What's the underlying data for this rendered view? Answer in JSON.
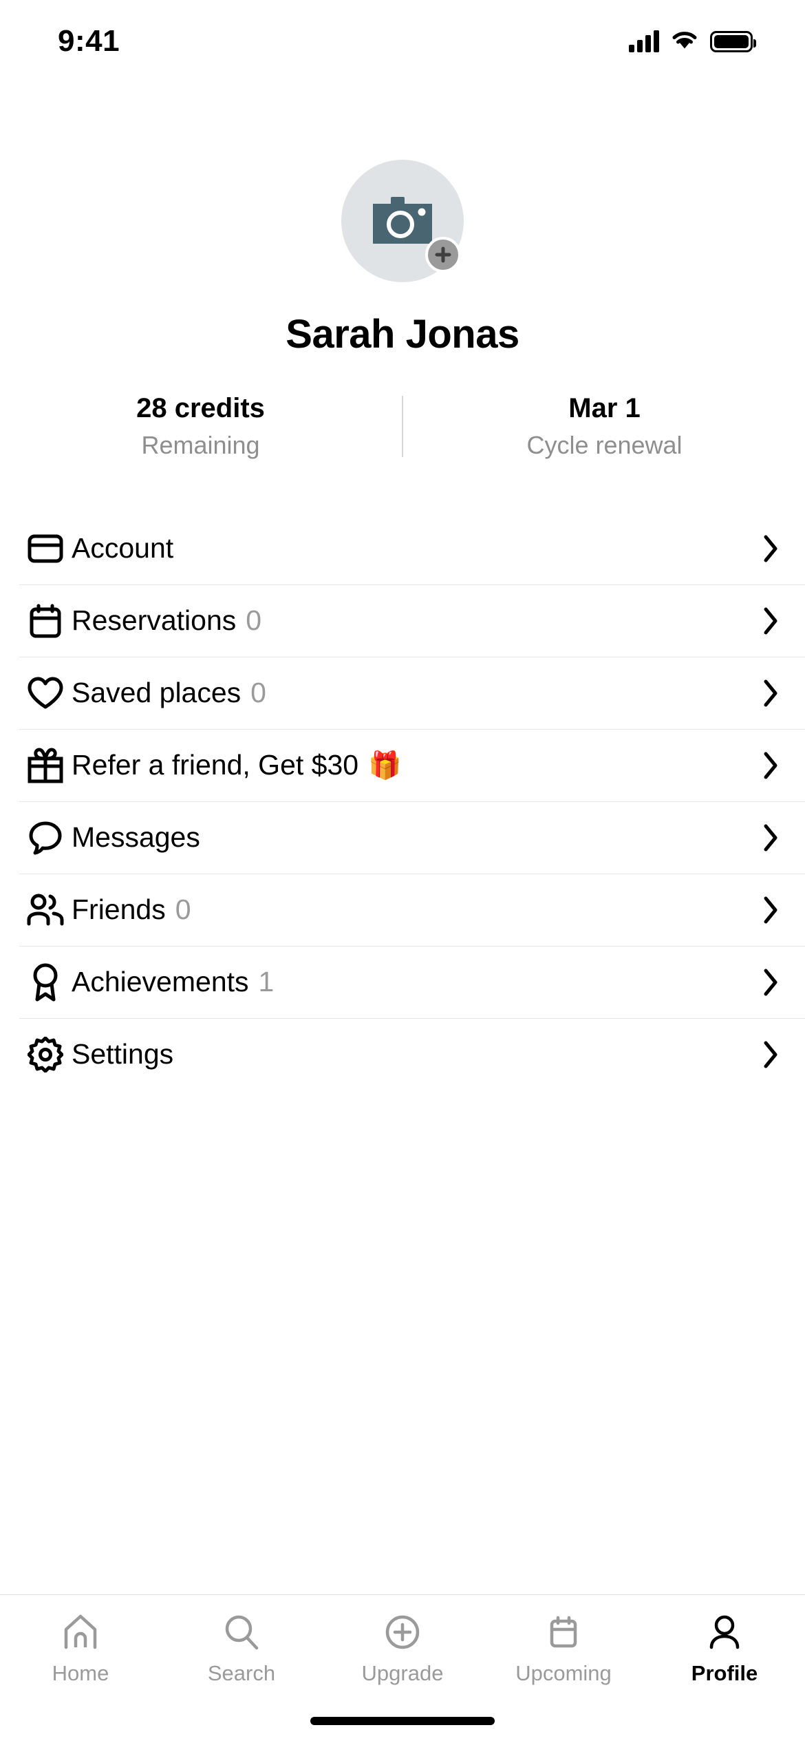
{
  "status_bar": {
    "time": "9:41",
    "signal_icon": "cellular-signal-icon",
    "wifi_icon": "wifi-icon",
    "battery_icon": "battery-icon"
  },
  "profile": {
    "avatar_icon": "camera-icon",
    "avatar_badge_icon": "plus-icon",
    "name": "Sarah Jonas",
    "stats": [
      {
        "value": "28 credits",
        "label": "Remaining"
      },
      {
        "value": "Mar 1",
        "label": "Cycle renewal"
      }
    ]
  },
  "menu": {
    "items": [
      {
        "icon": "credit-card-icon",
        "label": "Account",
        "count": "",
        "emoji": "",
        "chevron": "chevron-right-icon"
      },
      {
        "icon": "calendar-icon",
        "label": "Reservations",
        "count": "0",
        "emoji": "",
        "chevron": "chevron-right-icon"
      },
      {
        "icon": "heart-icon",
        "label": "Saved places",
        "count": "0",
        "emoji": "",
        "chevron": "chevron-right-icon"
      },
      {
        "icon": "gift-icon",
        "label": "Refer a friend, Get $30",
        "count": "",
        "emoji": "🎁",
        "chevron": "chevron-right-icon"
      },
      {
        "icon": "message-icon",
        "label": "Messages",
        "count": "",
        "emoji": "",
        "chevron": "chevron-right-icon"
      },
      {
        "icon": "users-icon",
        "label": "Friends",
        "count": "0",
        "emoji": "",
        "chevron": "chevron-right-icon"
      },
      {
        "icon": "award-icon",
        "label": "Achievements",
        "count": "1",
        "emoji": "",
        "chevron": "chevron-right-icon"
      },
      {
        "icon": "gear-icon",
        "label": "Settings",
        "count": "",
        "emoji": "",
        "chevron": "chevron-right-icon"
      }
    ]
  },
  "tabbar": {
    "items": [
      {
        "icon": "home-icon",
        "label": "Home",
        "active": false
      },
      {
        "icon": "search-icon",
        "label": "Search",
        "active": false
      },
      {
        "icon": "plus-circle-icon",
        "label": "Upgrade",
        "active": false
      },
      {
        "icon": "calendar-icon",
        "label": "Upcoming",
        "active": false
      },
      {
        "icon": "person-icon",
        "label": "Profile",
        "active": true
      }
    ]
  },
  "colors": {
    "text_primary": "#000000",
    "text_muted": "#8e8e8e",
    "divider": "#e6e6e6",
    "avatar_bg": "#dfe3e6",
    "avatar_camera": "#4a6572",
    "avatar_badge": "#9a9a9a"
  }
}
